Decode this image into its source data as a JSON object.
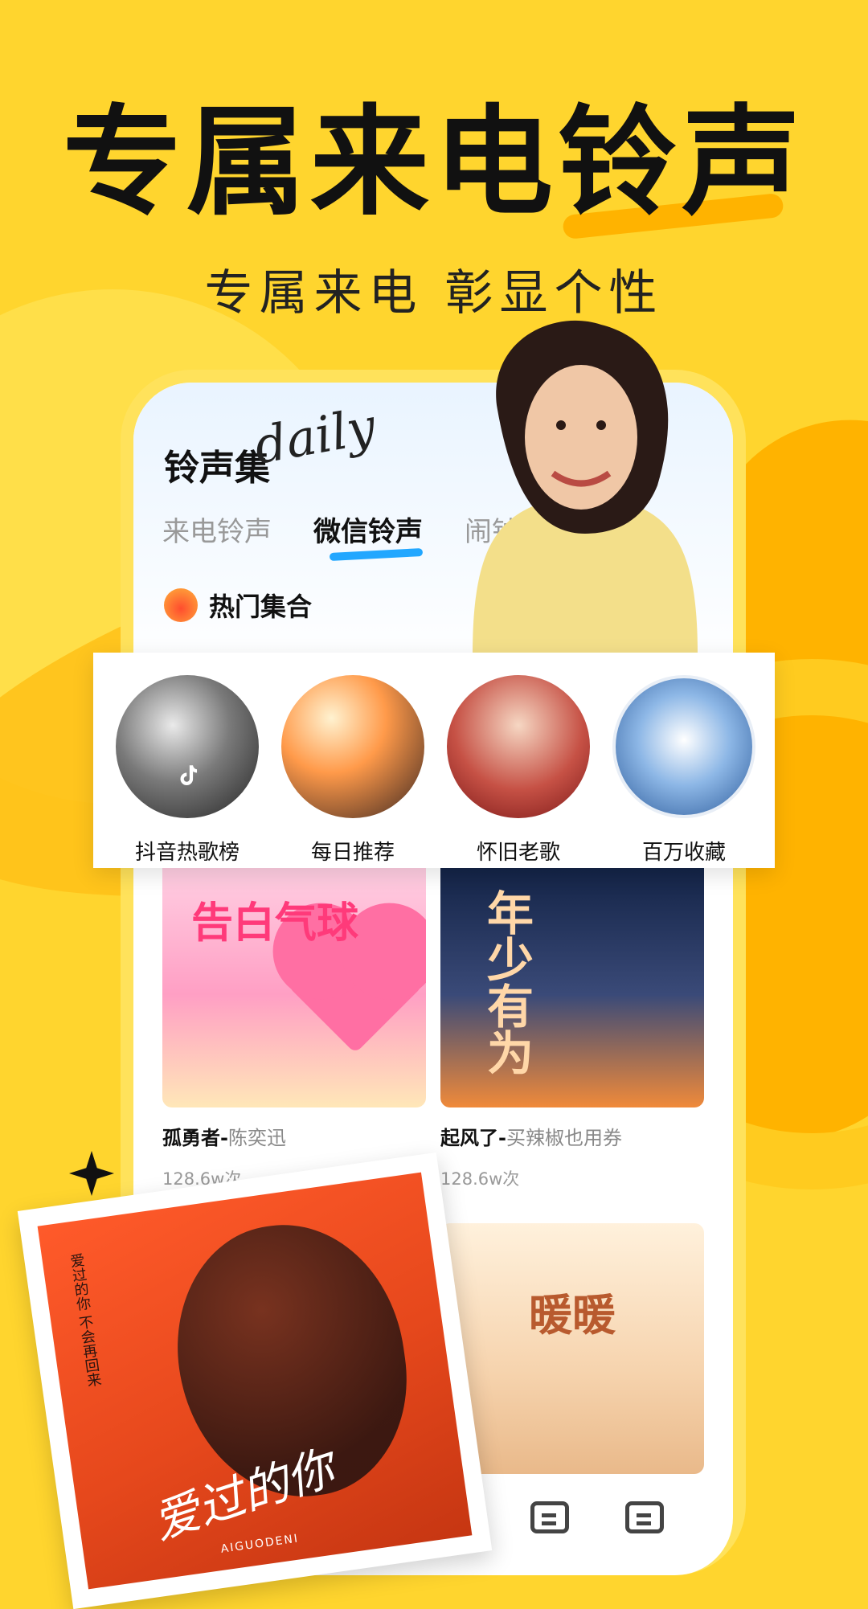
{
  "hero": {
    "title": "专属来电铃声",
    "subtitle": "专属来电 彰显个性"
  },
  "app": {
    "brand": "铃声集",
    "brand_script": "daily",
    "tabs": [
      {
        "label": "来电铃声",
        "active": false
      },
      {
        "label": "微信铃声",
        "active": true
      },
      {
        "label": "闹钟铃声",
        "active": false
      }
    ],
    "section": {
      "title": "热门集合"
    },
    "categories": [
      {
        "label": "抖音热歌榜",
        "icon": "tiktok-icon"
      },
      {
        "label": "每日推荐"
      },
      {
        "label": "怀旧老歌"
      },
      {
        "label": "百万收藏"
      }
    ],
    "cards": [
      {
        "song": "孤勇者",
        "artist": "陈奕迅",
        "plays": "128.6w次",
        "image_text": "告白气球"
      },
      {
        "song": "起风了",
        "artist": "买辣椒也用券",
        "plays": "128.6w次",
        "image_text": "年少有为"
      },
      {
        "song": "",
        "artist": "",
        "plays": "",
        "image_text": ""
      },
      {
        "song": "",
        "artist": "",
        "plays": "",
        "image_text": "暖暖"
      }
    ]
  },
  "album": {
    "vertical_text": "爱过的你 不会再回来",
    "script": "爱过的你",
    "small": "AIGUODENI"
  },
  "colors": {
    "background": "#ffd52e",
    "accent_orange": "#ffb300",
    "tab_underline": "#22a7ff"
  }
}
